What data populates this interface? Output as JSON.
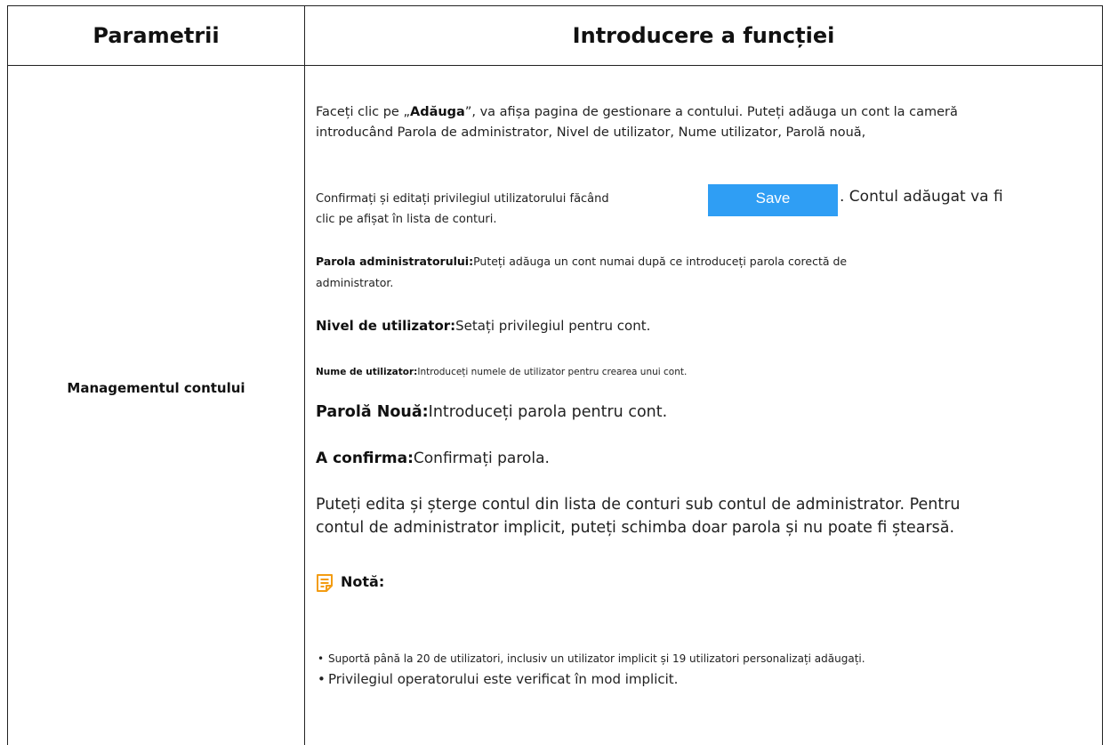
{
  "header": {
    "col1": "Parametrii",
    "col2": "Introducere a funcției"
  },
  "row": {
    "parameter": "Managementul contului",
    "intro": {
      "line1_pre": "Faceți clic pe „",
      "line1_bold": "Adăuga",
      "line1_post": "”, va afișa pagina de gestionare a contului. Puteți adăuga un cont la cameră",
      "line2": "introducând Parola de administrator, Nivel de utilizator, Nume utilizator, Parolă nouă,",
      "line3_pre": "Confirmați și editați privilegiul utilizatorului făcând",
      "save_button": "Save",
      "line3_post": ". Contul adăugat va fi",
      "line4": "clic pe afișat în lista de conturi."
    },
    "fields": {
      "admin_password_label": "Parola administratorului:",
      "admin_password_text": "Puteți adăuga un cont numai după ce introduceți parola corectă de",
      "admin_password_text2": "administrator.",
      "user_level_label": "Nivel de utilizator:",
      "user_level_text": "Setați privilegiul pentru cont.",
      "username_label": "Nume de utilizator:",
      "username_text": "Introduceți numele de utilizator pentru crearea unui cont.",
      "new_password_label": "Parolă Nouă:",
      "new_password_text": "Introduceți parola pentru cont.",
      "confirm_label": "A confirma:",
      "confirm_text": "Confirmați parola."
    },
    "edit_line1": "Puteți edita și șterge contul din lista de conturi sub contul de administrator. Pentru",
    "edit_line2": "contul de administrator implicit, puteți schimba doar parola și nu poate fi ștearsă.",
    "note": {
      "title": "Notă:",
      "icon": "note-icon",
      "items": [
        "Suportă până la 20 de utilizatori, inclusiv un utilizator implicit și 19 utilizatori personalizați adăugați.",
        "Privilegiul operatorului este verificat în mod implicit."
      ]
    }
  },
  "colors": {
    "save_button_bg": "#2f9ef4",
    "note_icon": "#f39c12",
    "border": "#222222"
  }
}
